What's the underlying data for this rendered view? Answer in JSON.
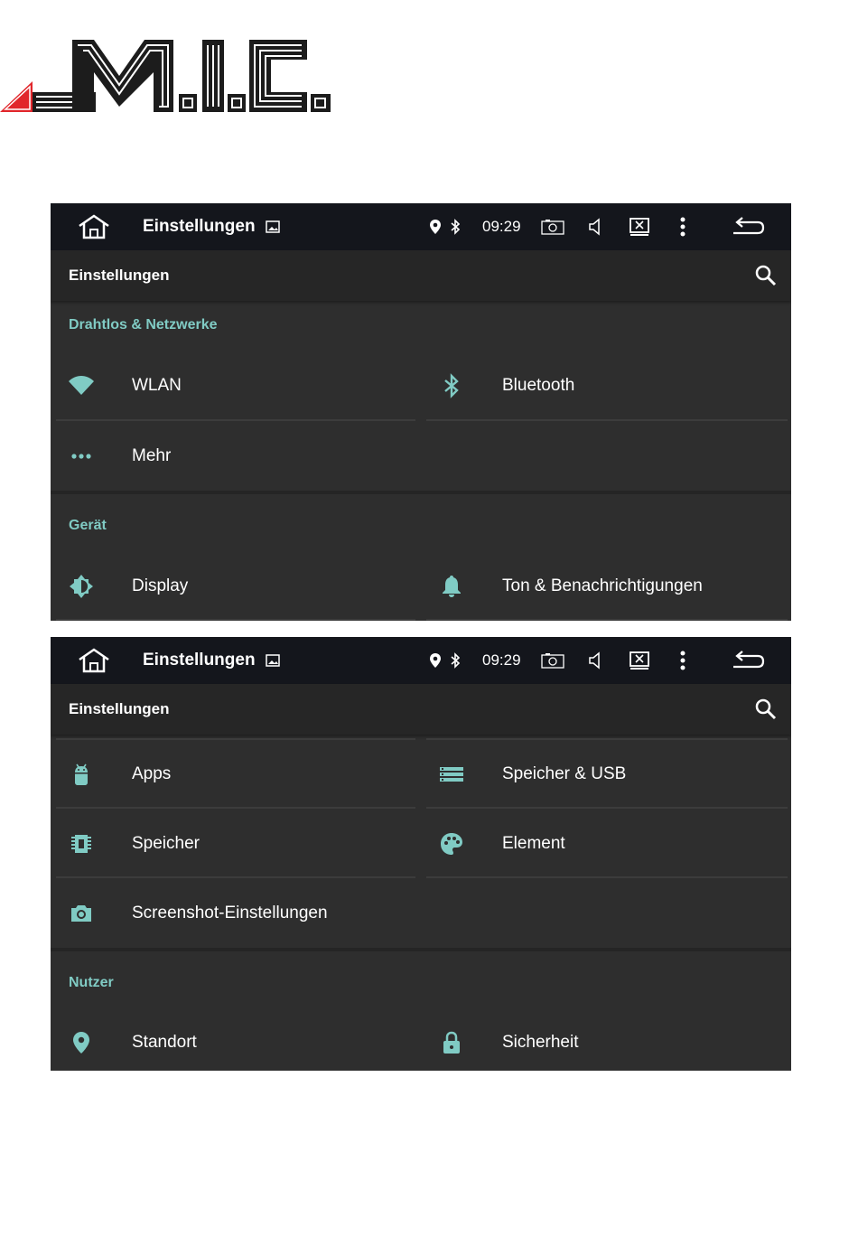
{
  "colors": {
    "accent": "#80cbc4",
    "background": "#2e2e2e",
    "statusbar": "#14161c",
    "appbar": "#262626",
    "text": "#ffffff"
  },
  "screen1": {
    "statusbar": {
      "title": "Einstellungen",
      "time": "09:29"
    },
    "appbar": {
      "title": "Einstellungen"
    },
    "sections": [
      {
        "title": "Drahtlos & Netzwerke",
        "items": [
          {
            "label": "WLAN",
            "icon": "wifi-icon"
          },
          {
            "label": "Bluetooth",
            "icon": "bluetooth-icon"
          },
          {
            "label": "Mehr",
            "icon": "more-dots-icon"
          }
        ]
      },
      {
        "title": "Gerät",
        "items": [
          {
            "label": "Display",
            "icon": "brightness-icon"
          },
          {
            "label": "Ton & Benachrichtigungen",
            "icon": "bell-icon"
          }
        ]
      }
    ]
  },
  "screen2": {
    "statusbar": {
      "title": "Einstellungen",
      "time": "09:29"
    },
    "appbar": {
      "title": "Einstellungen"
    },
    "items": [
      {
        "label": "Apps",
        "icon": "android-icon"
      },
      {
        "label": "Speicher & USB",
        "icon": "storage-icon"
      },
      {
        "label": "Speicher",
        "icon": "memory-chip-icon"
      },
      {
        "label": "Element",
        "icon": "palette-icon"
      },
      {
        "label": "Screenshot-Einstellungen",
        "icon": "camera-icon"
      }
    ],
    "sections": [
      {
        "title": "Nutzer",
        "items": [
          {
            "label": "Standort",
            "icon": "location-pin-icon"
          },
          {
            "label": "Sicherheit",
            "icon": "lock-icon"
          }
        ]
      }
    ]
  }
}
